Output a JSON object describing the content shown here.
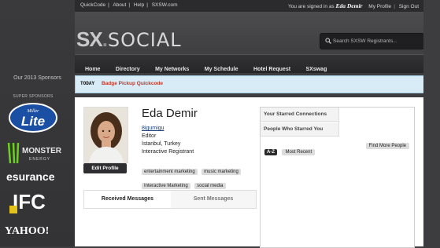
{
  "topbar": {
    "links": [
      "QuickCode",
      "About",
      "Help",
      "SXSW.com"
    ],
    "signed_in_prefix": "You are signed in as",
    "user_name": "Eda Demir",
    "my_profile": "My Profile",
    "sign_out": "Sign Out"
  },
  "brand": {
    "sx": "SX",
    "social": "SOCIAL"
  },
  "search": {
    "placeholder": "Search SXSW Registrants..."
  },
  "nav": [
    "Home",
    "Directory",
    "My Networks",
    "My Schedule",
    "Hotel Request",
    "SXswag"
  ],
  "alert": {
    "tag": "TODAY",
    "text": "Badge Pickup Quickcode"
  },
  "sidebar": {
    "sponsors_title": "Our 2013 Sponsors",
    "super_sponsors": "SUPER SPONSORS",
    "logos": [
      "Miller Lite",
      "Monster Energy",
      "esurance",
      "IFC",
      "Yahoo!"
    ]
  },
  "profile": {
    "name": "Eda Demir",
    "username": "8igumigu",
    "role": "Editor",
    "location": "İstanbul, Turkey",
    "registrant_type": "Interactive Registrant",
    "edit_label": "Edit Profile",
    "tags": [
      "entertainment marketing",
      "music marketing",
      "Interactive Marketing",
      "social media"
    ]
  },
  "messages": {
    "received": "Received Messages",
    "sent": "Sent Messages"
  },
  "connections": {
    "tab_starred": "Your Starred Connections",
    "tab_starred_you": "People Who Starred You",
    "sort_az": "A-Z",
    "sort_recent": "Most Recent",
    "find_more": "Find More People"
  },
  "colors": {
    "alert_bg": "#d7ecf6",
    "alert_text": "#c0392b",
    "page_bg": "#3d3d3f"
  }
}
